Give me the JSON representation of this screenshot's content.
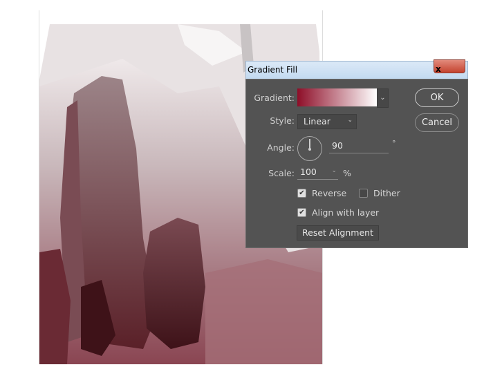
{
  "dialog": {
    "title": "Gradient Fill",
    "close_label": "x",
    "gradient": {
      "label": "Gradient:",
      "start_color": "#8e0e28",
      "end_color": "#ffffff"
    },
    "style": {
      "label": "Style:",
      "value": "Linear"
    },
    "angle": {
      "label": "Angle:",
      "value": "90",
      "unit": "°"
    },
    "scale": {
      "label": "Scale:",
      "value": "100",
      "unit": "%"
    },
    "reverse": {
      "label": "Reverse",
      "checked": true
    },
    "dither": {
      "label": "Dither",
      "checked": false
    },
    "align": {
      "label": "Align with layer",
      "checked": true
    },
    "reset_label": "Reset Alignment",
    "ok_label": "OK",
    "cancel_label": "Cancel"
  },
  "canvas": {
    "colors": {
      "dark": "#4a1a20",
      "mid": "#8c5a62",
      "light": "#d9cfd1"
    }
  }
}
